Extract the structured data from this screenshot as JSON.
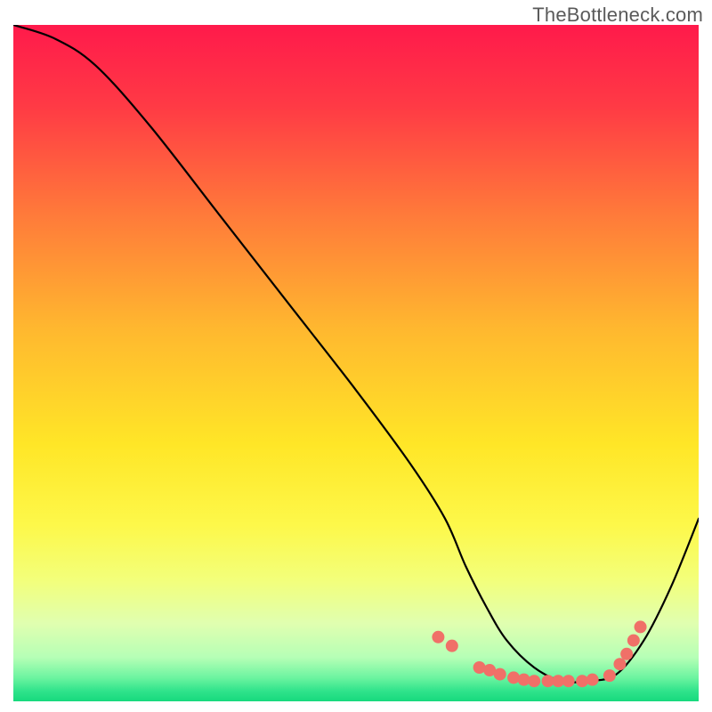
{
  "watermark": {
    "text": "TheBottleneck.com"
  },
  "chart_data": {
    "type": "line",
    "title": "",
    "xlabel": "",
    "ylabel": "",
    "xlim": [
      0,
      100
    ],
    "ylim": [
      0,
      100
    ],
    "gradient_stops": [
      {
        "offset": 0.0,
        "color": "#ff1a4b"
      },
      {
        "offset": 0.12,
        "color": "#ff3a45"
      },
      {
        "offset": 0.28,
        "color": "#ff7a3a"
      },
      {
        "offset": 0.45,
        "color": "#ffb82f"
      },
      {
        "offset": 0.62,
        "color": "#ffe627"
      },
      {
        "offset": 0.74,
        "color": "#fdf84a"
      },
      {
        "offset": 0.82,
        "color": "#f3ff7a"
      },
      {
        "offset": 0.885,
        "color": "#e0ffb0"
      },
      {
        "offset": 0.935,
        "color": "#b6ffb6"
      },
      {
        "offset": 0.965,
        "color": "#6cf4a0"
      },
      {
        "offset": 0.985,
        "color": "#2fe38b"
      },
      {
        "offset": 1.0,
        "color": "#17d97d"
      }
    ],
    "series": [
      {
        "name": "bottleneck-curve",
        "x": [
          0,
          6,
          12,
          20,
          30,
          40,
          50,
          58,
          63,
          66,
          69,
          72,
          76,
          80,
          84,
          88,
          92,
          96,
          100
        ],
        "values": [
          100,
          98,
          94,
          85,
          72,
          59,
          46,
          35,
          27,
          20,
          14,
          9,
          5,
          3,
          3,
          4,
          9,
          17,
          27
        ]
      }
    ],
    "markers": {
      "name": "highlight-band",
      "color": "#f07068",
      "radius_px": 7,
      "points_xy": [
        [
          62,
          9.5
        ],
        [
          64,
          8.2
        ],
        [
          68,
          5.0
        ],
        [
          69.5,
          4.6
        ],
        [
          71,
          4.0
        ],
        [
          73,
          3.5
        ],
        [
          74.5,
          3.2
        ],
        [
          76,
          3.0
        ],
        [
          78,
          3.0
        ],
        [
          79.5,
          3.0
        ],
        [
          81,
          3.0
        ],
        [
          83,
          3.0
        ],
        [
          84.5,
          3.2
        ],
        [
          87,
          3.8
        ],
        [
          88.5,
          5.5
        ],
        [
          89.5,
          7.0
        ],
        [
          90.5,
          9.0
        ],
        [
          91.5,
          11.0
        ]
      ]
    }
  }
}
